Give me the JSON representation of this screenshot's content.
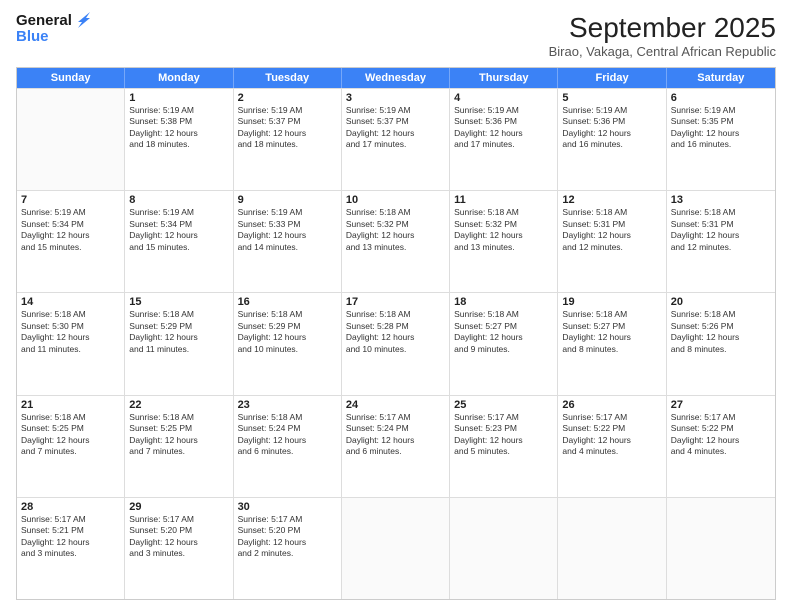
{
  "header": {
    "logo_line1": "General",
    "logo_line2": "Blue",
    "month_title": "September 2025",
    "subtitle": "Birao, Vakaga, Central African Republic"
  },
  "days": [
    "Sunday",
    "Monday",
    "Tuesday",
    "Wednesday",
    "Thursday",
    "Friday",
    "Saturday"
  ],
  "rows": [
    [
      {
        "day": "",
        "text": ""
      },
      {
        "day": "1",
        "text": "Sunrise: 5:19 AM\nSunset: 5:38 PM\nDaylight: 12 hours\nand 18 minutes."
      },
      {
        "day": "2",
        "text": "Sunrise: 5:19 AM\nSunset: 5:37 PM\nDaylight: 12 hours\nand 18 minutes."
      },
      {
        "day": "3",
        "text": "Sunrise: 5:19 AM\nSunset: 5:37 PM\nDaylight: 12 hours\nand 17 minutes."
      },
      {
        "day": "4",
        "text": "Sunrise: 5:19 AM\nSunset: 5:36 PM\nDaylight: 12 hours\nand 17 minutes."
      },
      {
        "day": "5",
        "text": "Sunrise: 5:19 AM\nSunset: 5:36 PM\nDaylight: 12 hours\nand 16 minutes."
      },
      {
        "day": "6",
        "text": "Sunrise: 5:19 AM\nSunset: 5:35 PM\nDaylight: 12 hours\nand 16 minutes."
      }
    ],
    [
      {
        "day": "7",
        "text": "Sunrise: 5:19 AM\nSunset: 5:34 PM\nDaylight: 12 hours\nand 15 minutes."
      },
      {
        "day": "8",
        "text": "Sunrise: 5:19 AM\nSunset: 5:34 PM\nDaylight: 12 hours\nand 15 minutes."
      },
      {
        "day": "9",
        "text": "Sunrise: 5:19 AM\nSunset: 5:33 PM\nDaylight: 12 hours\nand 14 minutes."
      },
      {
        "day": "10",
        "text": "Sunrise: 5:18 AM\nSunset: 5:32 PM\nDaylight: 12 hours\nand 13 minutes."
      },
      {
        "day": "11",
        "text": "Sunrise: 5:18 AM\nSunset: 5:32 PM\nDaylight: 12 hours\nand 13 minutes."
      },
      {
        "day": "12",
        "text": "Sunrise: 5:18 AM\nSunset: 5:31 PM\nDaylight: 12 hours\nand 12 minutes."
      },
      {
        "day": "13",
        "text": "Sunrise: 5:18 AM\nSunset: 5:31 PM\nDaylight: 12 hours\nand 12 minutes."
      }
    ],
    [
      {
        "day": "14",
        "text": "Sunrise: 5:18 AM\nSunset: 5:30 PM\nDaylight: 12 hours\nand 11 minutes."
      },
      {
        "day": "15",
        "text": "Sunrise: 5:18 AM\nSunset: 5:29 PM\nDaylight: 12 hours\nand 11 minutes."
      },
      {
        "day": "16",
        "text": "Sunrise: 5:18 AM\nSunset: 5:29 PM\nDaylight: 12 hours\nand 10 minutes."
      },
      {
        "day": "17",
        "text": "Sunrise: 5:18 AM\nSunset: 5:28 PM\nDaylight: 12 hours\nand 10 minutes."
      },
      {
        "day": "18",
        "text": "Sunrise: 5:18 AM\nSunset: 5:27 PM\nDaylight: 12 hours\nand 9 minutes."
      },
      {
        "day": "19",
        "text": "Sunrise: 5:18 AM\nSunset: 5:27 PM\nDaylight: 12 hours\nand 8 minutes."
      },
      {
        "day": "20",
        "text": "Sunrise: 5:18 AM\nSunset: 5:26 PM\nDaylight: 12 hours\nand 8 minutes."
      }
    ],
    [
      {
        "day": "21",
        "text": "Sunrise: 5:18 AM\nSunset: 5:25 PM\nDaylight: 12 hours\nand 7 minutes."
      },
      {
        "day": "22",
        "text": "Sunrise: 5:18 AM\nSunset: 5:25 PM\nDaylight: 12 hours\nand 7 minutes."
      },
      {
        "day": "23",
        "text": "Sunrise: 5:18 AM\nSunset: 5:24 PM\nDaylight: 12 hours\nand 6 minutes."
      },
      {
        "day": "24",
        "text": "Sunrise: 5:17 AM\nSunset: 5:24 PM\nDaylight: 12 hours\nand 6 minutes."
      },
      {
        "day": "25",
        "text": "Sunrise: 5:17 AM\nSunset: 5:23 PM\nDaylight: 12 hours\nand 5 minutes."
      },
      {
        "day": "26",
        "text": "Sunrise: 5:17 AM\nSunset: 5:22 PM\nDaylight: 12 hours\nand 4 minutes."
      },
      {
        "day": "27",
        "text": "Sunrise: 5:17 AM\nSunset: 5:22 PM\nDaylight: 12 hours\nand 4 minutes."
      }
    ],
    [
      {
        "day": "28",
        "text": "Sunrise: 5:17 AM\nSunset: 5:21 PM\nDaylight: 12 hours\nand 3 minutes."
      },
      {
        "day": "29",
        "text": "Sunrise: 5:17 AM\nSunset: 5:20 PM\nDaylight: 12 hours\nand 3 minutes."
      },
      {
        "day": "30",
        "text": "Sunrise: 5:17 AM\nSunset: 5:20 PM\nDaylight: 12 hours\nand 2 minutes."
      },
      {
        "day": "",
        "text": ""
      },
      {
        "day": "",
        "text": ""
      },
      {
        "day": "",
        "text": ""
      },
      {
        "day": "",
        "text": ""
      }
    ]
  ]
}
